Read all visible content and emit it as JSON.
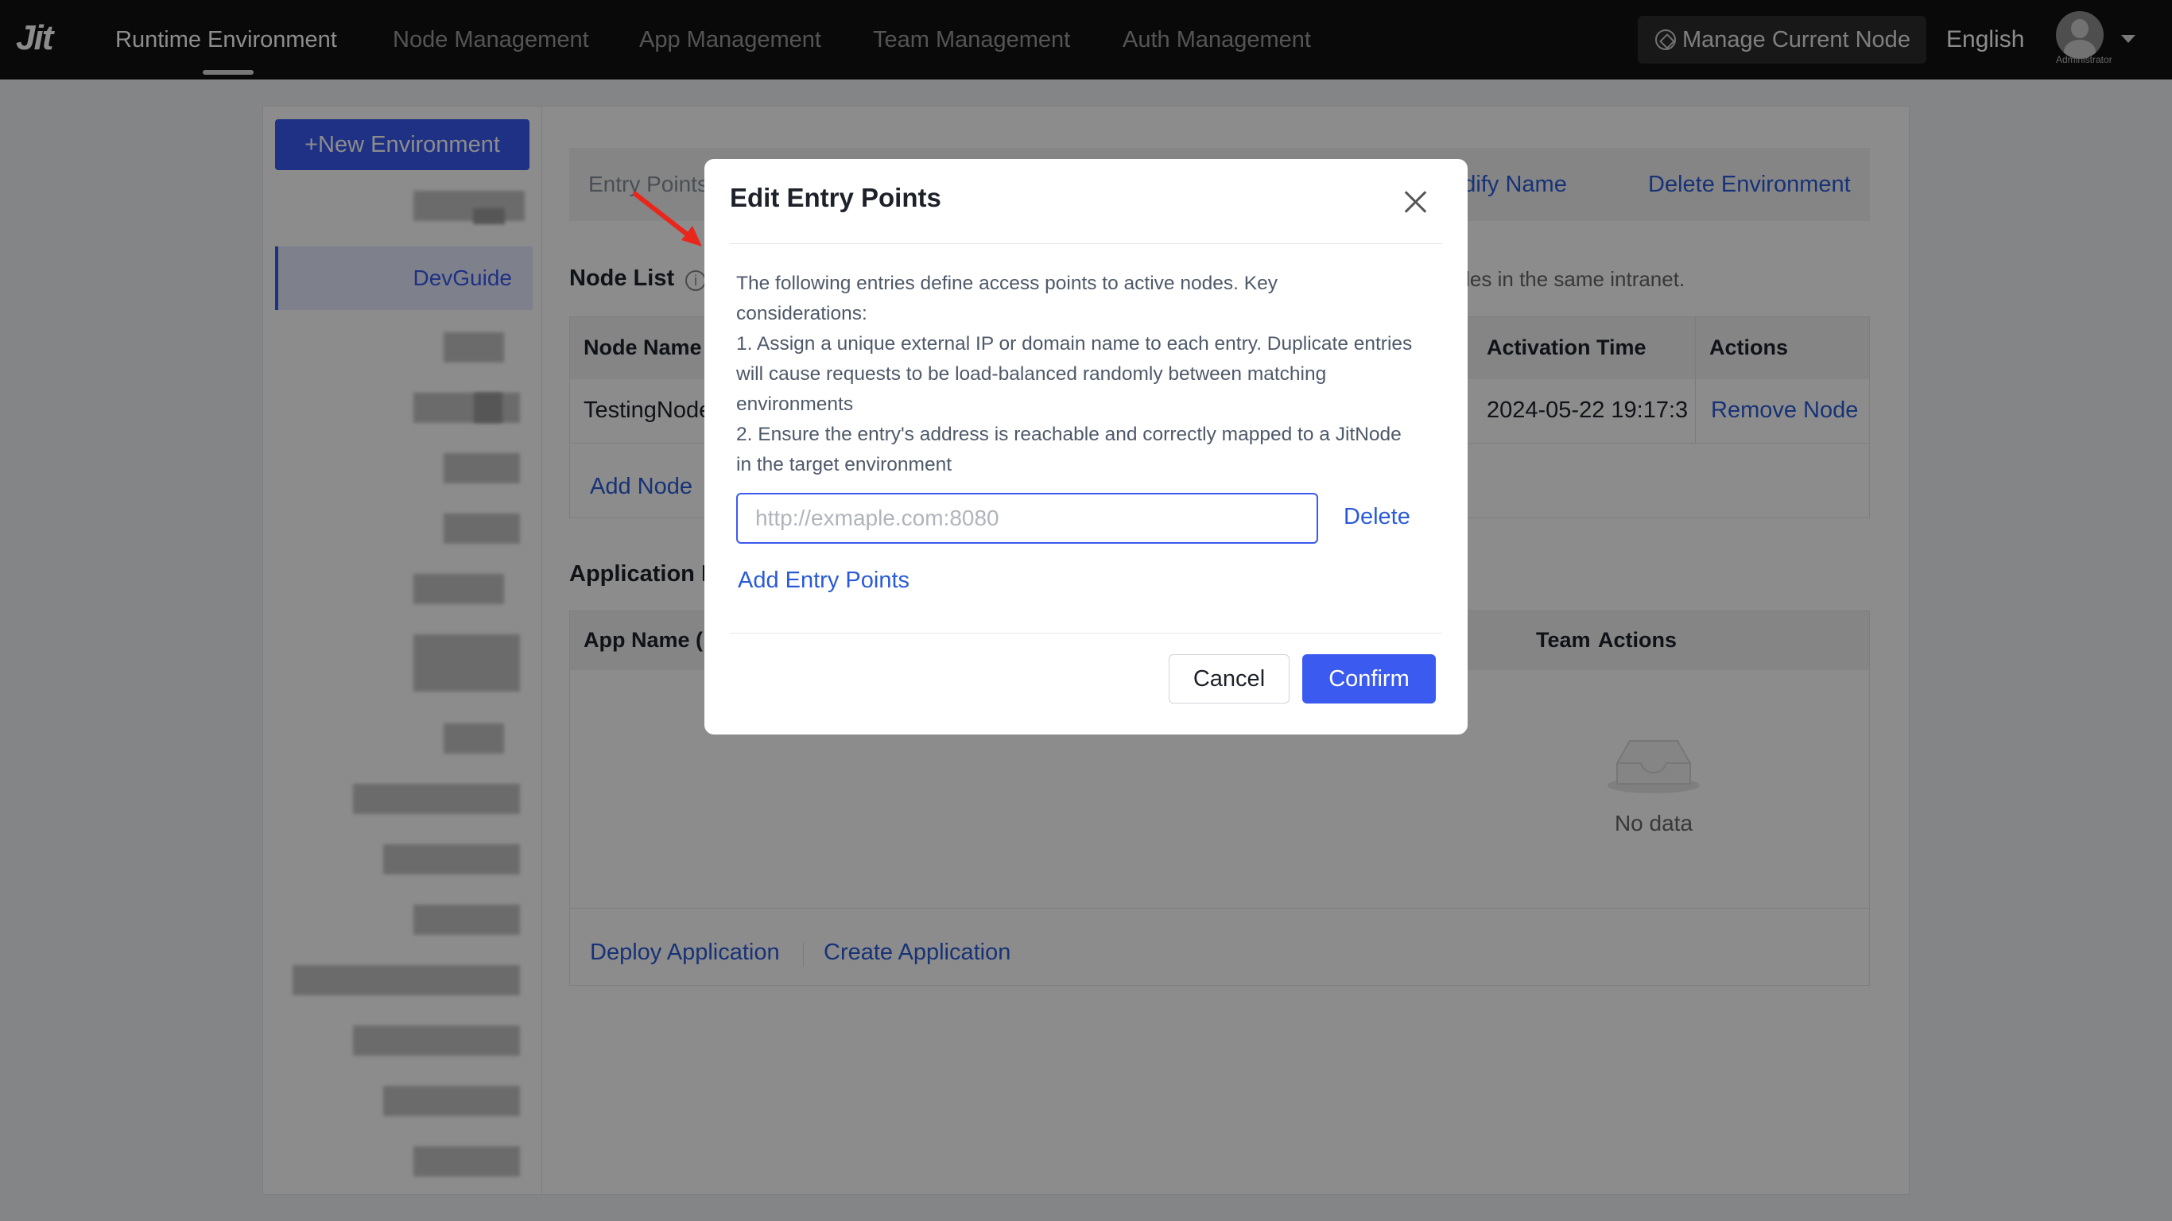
{
  "topbar": {
    "logo": "Jit",
    "nav": [
      "Runtime Environment",
      "Node Management",
      "App Management",
      "Team Management",
      "Auth Management"
    ],
    "manage_node": "Manage Current Node",
    "language": "English",
    "user_role": "Administrator"
  },
  "sidebar": {
    "new_env": "+New Environment",
    "active_item": "DevGuide"
  },
  "env_bar": {
    "entry_points": "Entry Points",
    "modify_name": "Modify Name",
    "delete_env": "Delete Environment"
  },
  "node_section": {
    "title": "Node List",
    "hint": "odes in the same intranet.",
    "columns": [
      "Node Name",
      "Activation Time",
      "Actions"
    ],
    "row": {
      "name": "TestingNode",
      "activation": "2024-05-22 19:17:3",
      "action": "Remove Node"
    },
    "add_node": "Add Node"
  },
  "app_section": {
    "title": "Application L",
    "columns": [
      "App Name (",
      "Team",
      "Actions"
    ],
    "empty": "No data",
    "deploy": "Deploy Application",
    "create": "Create Application"
  },
  "modal": {
    "title": "Edit Entry Points",
    "desc_lines": [
      "The following entries define access points to active nodes. Key",
      "considerations:",
      "1. Assign a unique external IP or domain name to each entry. Duplicate entries",
      "will cause requests to be load-balanced randomly between matching",
      "environments",
      "2. Ensure the entry's address is reachable and correctly mapped to a JitNode",
      "in the target environment"
    ],
    "input_placeholder": "http://exmaple.com:8080",
    "input_value": "",
    "delete": "Delete",
    "add_entry": "Add Entry Points",
    "cancel": "Cancel",
    "confirm": "Confirm"
  },
  "colors": {
    "accent": "#3a5af0",
    "link": "#2a5bd7",
    "topbar": "#121212",
    "arrow": "#e8261b"
  }
}
